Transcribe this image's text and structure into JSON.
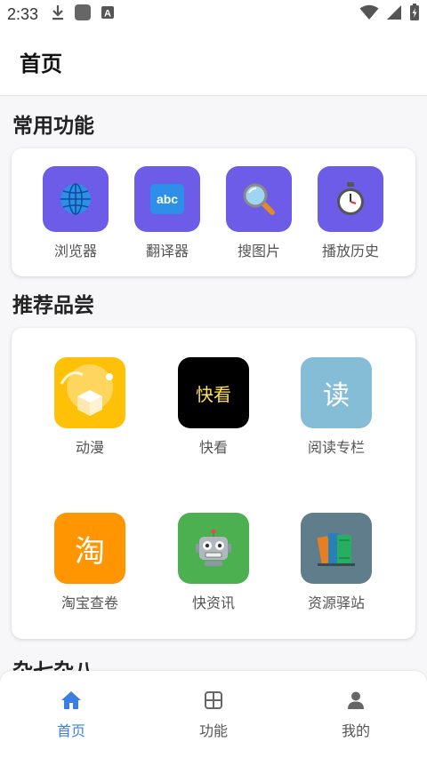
{
  "status_bar": {
    "time": "2:33",
    "left_icons": [
      "download-icon",
      "app-square-icon",
      "a-badge-icon"
    ],
    "right_icons": [
      "wifi-icon",
      "signal-icon",
      "battery-charging-icon"
    ]
  },
  "header": {
    "title": "首页"
  },
  "common_functions": {
    "title": "常用功能",
    "items": [
      {
        "label": "浏览器",
        "icon": "globe-icon"
      },
      {
        "label": "翻译器",
        "icon": "abc-icon",
        "icon_text": "abc"
      },
      {
        "label": "搜图片",
        "icon": "magnifier-icon"
      },
      {
        "label": "播放历史",
        "icon": "stopwatch-icon"
      }
    ],
    "icon_bg": "#6c5ce7"
  },
  "recommended": {
    "title": "推荐品尝",
    "items": [
      {
        "label": "动漫",
        "icon": "anime-box-icon",
        "bg": "#ffc107"
      },
      {
        "label": "快看",
        "icon": "kuaikan-icon",
        "icon_text": "快看",
        "bg": "#000000",
        "text_color": "#ffe14d"
      },
      {
        "label": "阅读专栏",
        "icon": "read-icon",
        "icon_text": "读",
        "bg": "#85bcd6",
        "text_color": "#ffffff"
      },
      {
        "label": "淘宝查卷",
        "icon": "taobao-icon",
        "icon_text": "淘",
        "bg": "#ff9500",
        "text_color": "#ffffff"
      },
      {
        "label": "快资讯",
        "icon": "robot-icon",
        "bg": "#4caf50"
      },
      {
        "label": "资源驿站",
        "icon": "books-icon",
        "bg": "#607d8b"
      }
    ]
  },
  "misc": {
    "title": "杂七杂八"
  },
  "bottom_nav": {
    "items": [
      {
        "label": "首页",
        "icon": "home-icon",
        "active": true
      },
      {
        "label": "功能",
        "icon": "grid-icon",
        "active": false
      },
      {
        "label": "我的",
        "icon": "person-icon",
        "active": false
      }
    ],
    "active_color": "#3d7fe0",
    "inactive_color": "#555555"
  }
}
